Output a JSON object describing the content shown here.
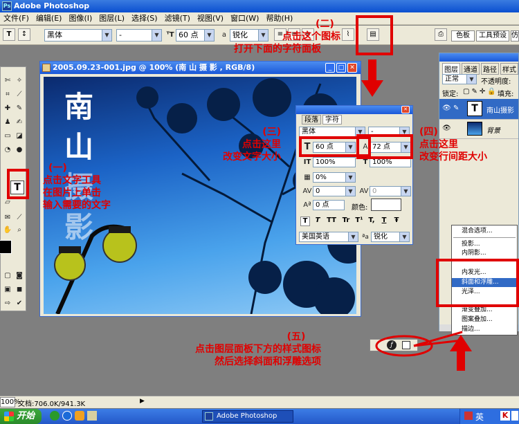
{
  "window": {
    "title": "Adobe Photoshop"
  },
  "menu": [
    "文件(F)",
    "编辑(E)",
    "图像(I)",
    "图层(L)",
    "选择(S)",
    "滤镜(T)",
    "视图(V)",
    "窗口(W)",
    "帮助(H)"
  ],
  "options": {
    "font_family": "黑体",
    "font_style": "-",
    "font_size": "60 点",
    "aa_label": "a",
    "aa_mode": "锐化",
    "tabs": [
      "色板",
      "工具预设",
      "仿"
    ]
  },
  "image_window": {
    "title": "2005.09.23-001.jpg @ 100% (南 山 摄 影 , RGB/8)",
    "text_chars": [
      "南",
      "山",
      "摄",
      "影"
    ]
  },
  "char_panel": {
    "tabs": [
      "段落",
      "字符"
    ],
    "font": "黑体",
    "style": "-",
    "size": "60 点",
    "leading": "72 点",
    "vscale": "100%",
    "hscale": "100%",
    "tracking_pct": "0%",
    "tracking": "0",
    "kerning": "0",
    "baseline": "0 点",
    "color_label": "颜色:",
    "language": "美国英语",
    "aa": "锐化",
    "style_buttons": [
      "T",
      "T",
      "TT",
      "Tr",
      "T¹",
      "T,",
      "T",
      "Ŧ"
    ]
  },
  "layers": {
    "tabs": [
      "图层",
      "通道",
      "路径",
      "样式"
    ],
    "blend": "正常",
    "opacity_label": "不透明度:",
    "lock_label": "锁定:",
    "fill_label": "填充:",
    "items": [
      {
        "name": "南山摄影",
        "thumb": "T"
      },
      {
        "name": "背景"
      }
    ]
  },
  "context_menu": {
    "items": [
      "混合选项...",
      "投影...",
      "内阴影...",
      "内发光...",
      "斜面和浮雕...",
      "光泽...",
      "渐变叠加...",
      "图案叠加...",
      "描边..."
    ],
    "highlighted": "斜面和浮雕..."
  },
  "annotations": {
    "a1": [
      "(一)",
      "点击文字工具",
      "在图片上单击",
      "输入需要的文字"
    ],
    "a2": [
      "(二)",
      "点击这个图标",
      "打开下面的字符面板"
    ],
    "a3": [
      "(三)",
      "点击这里",
      "改变文字大小"
    ],
    "a4": [
      "(四)",
      "点击这里",
      "改变行间距大小"
    ],
    "a5": [
      "(五)",
      "点击图层面板下方的样式图标",
      "然后选择斜面和浮雕选项"
    ]
  },
  "status": {
    "zoom": "100%",
    "doc": "文档:706.0K/941.3K"
  },
  "taskbar": {
    "start": "开始",
    "task": "Adobe Photoshop",
    "lang": "英"
  },
  "colors": {
    "annotation": "#e00000",
    "titlebar": "#0a4fd0"
  }
}
